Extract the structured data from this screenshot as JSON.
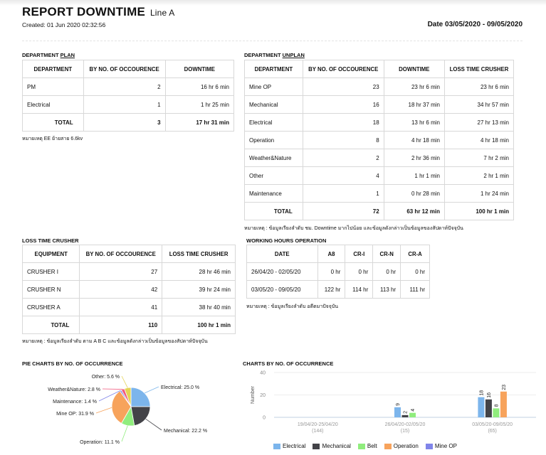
{
  "header": {
    "title": "REPORT DOWNTIME",
    "subtitle": "Line A",
    "created": "Created: 01 Jun 2020 02:32:56",
    "date_range": "Date 03/05/2020 - 09/05/2020"
  },
  "plan": {
    "title_prefix": "DEPARTMENT ",
    "title_underlined": "PLAN",
    "headers": [
      "DEPARTMENT",
      "BY NO. OF OCCOURENCE",
      "DOWNTIME"
    ],
    "rows": [
      [
        "PM",
        "2",
        "16 hr 6 min"
      ],
      [
        "Electrical",
        "1",
        "1 hr 25 min"
      ]
    ],
    "total": [
      "TOTAL",
      "3",
      "17 hr 31 min"
    ],
    "note": "หมายเหตุ EE ย้ายสาย 6.6kv"
  },
  "unplan": {
    "title_prefix": "DEPARTMENT ",
    "title_underlined": "UNPLAN",
    "headers": [
      "DEPARTMENT",
      "BY NO. OF OCCOURENCE",
      "DOWNTIME",
      "LOSS TIME CRUSHER"
    ],
    "rows": [
      [
        "Mine OP",
        "23",
        "23 hr 6 min",
        "23 hr 6 min"
      ],
      [
        "Mechanical",
        "16",
        "18 hr 37 min",
        "34 hr 57 min"
      ],
      [
        "Electrical",
        "18",
        "13 hr 6 min",
        "27 hr 13 min"
      ],
      [
        "Operation",
        "8",
        "4 hr 18 min",
        "4 hr 18 min"
      ],
      [
        "Weather&Nature",
        "2",
        "2 hr 36 min",
        "7 hr 2 min"
      ],
      [
        "Other",
        "4",
        "1 hr 1 min",
        "2 hr 1 min"
      ],
      [
        "Maintenance",
        "1",
        "0 hr 28 min",
        "1 hr 24 min"
      ]
    ],
    "total": [
      "TOTAL",
      "72",
      "63 hr 12 min",
      "100 hr 1 min"
    ],
    "note": "หมายเหตุ : ข้อมูลเรียงลำดับ ชม. Downtime มากไปน้อย และข้อมูลดังกล่าวเป็นข้อมูลของสัปดาห์ปัจจุบัน"
  },
  "loss": {
    "title": "LOSS TIME CRUSHER",
    "headers": [
      "EQUIPMENT",
      "BY NO. OF OCCOURENCE",
      "LOSS TIME CRUSHER"
    ],
    "rows": [
      [
        "CRUSHER I",
        "27",
        "28 hr 46 min"
      ],
      [
        "CRUSHER N",
        "42",
        "39 hr 24 min"
      ],
      [
        "CRUSHER A",
        "41",
        "38 hr 40 min"
      ]
    ],
    "total": [
      "TOTAL",
      "110",
      "100 hr 1 min"
    ],
    "note": "หมายเหตุ : ข้อมูลเรียงลำดับ ตาม A B C และข้อมูลดังกล่าวเป็นข้อมูลของสัปดาห์ปัจจุบัน"
  },
  "working": {
    "title": "WORKING HOURS OPERATION",
    "headers": [
      "DATE",
      "A8",
      "CR-I",
      "CR-N",
      "CR-A"
    ],
    "rows": [
      [
        "26/04/20 - 02/05/20",
        "0 hr",
        "0 hr",
        "0 hr",
        "0 hr"
      ],
      [
        "03/05/20 - 09/05/20",
        "122 hr",
        "114 hr",
        "113 hr",
        "111 hr"
      ]
    ],
    "note": "หมายเหตุ : ข้อมูลเรียงลำดับ อดีตมาปัจจุบัน"
  },
  "pie_title": "PIE CHARTS BY NO. OF OCCURRENCE",
  "bar_title": "CHARTS BY NO. OF OCCURRENCE",
  "chart_data": [
    {
      "type": "pie",
      "title": "PIE CHARTS BY NO. OF OCCURRENCE",
      "slices": [
        {
          "label": "Electrical",
          "value": 25.0,
          "text": "Electrical: 25.0 %",
          "color": "#7cb5ec"
        },
        {
          "label": "Mechanical",
          "value": 22.2,
          "text": "Mechanical: 22.2 %",
          "color": "#434348"
        },
        {
          "label": "Operation",
          "value": 11.1,
          "text": "Operation: 11.1 %",
          "color": "#90ed7d"
        },
        {
          "label": "Mine OP",
          "value": 31.9,
          "text": "Mine OP: 31.9 %",
          "color": "#f7a35c"
        },
        {
          "label": "Maintenance",
          "value": 1.4,
          "text": "Maintenance: 1.4 %",
          "color": "#8085e9"
        },
        {
          "label": "Weather&Nature",
          "value": 2.8,
          "text": "Weather&Nature: 2.8 %",
          "color": "#f15c80"
        },
        {
          "label": "Other",
          "value": 5.6,
          "text": "Other: 5.6 %",
          "color": "#e4d354"
        }
      ]
    },
    {
      "type": "bar",
      "title": "CHARTS BY NO. OF OCCURRENCE",
      "ylabel": "Number",
      "ylim": [
        0,
        40
      ],
      "yticks": [
        0,
        20,
        40
      ],
      "categories": [
        {
          "range": "19/04/20-25/04/20",
          "count": "(144)"
        },
        {
          "range": "26/04/20-02/05/20",
          "count": "(15)"
        },
        {
          "range": "03/05/20-09/05/20",
          "count": "(65)"
        }
      ],
      "series": [
        {
          "name": "Electrical",
          "color": "#7cb5ec",
          "values": [
            null,
            9,
            18
          ]
        },
        {
          "name": "Mechanical",
          "color": "#434348",
          "values": [
            null,
            2,
            16
          ]
        },
        {
          "name": "Belt",
          "color": "#90ed7d",
          "values": [
            null,
            4,
            8
          ]
        },
        {
          "name": "Operation",
          "color": "#f7a35c",
          "values": [
            null,
            null,
            23
          ]
        },
        {
          "name": "Mine OP",
          "color": "#8085e9",
          "values": [
            null,
            null,
            null
          ]
        }
      ]
    }
  ]
}
